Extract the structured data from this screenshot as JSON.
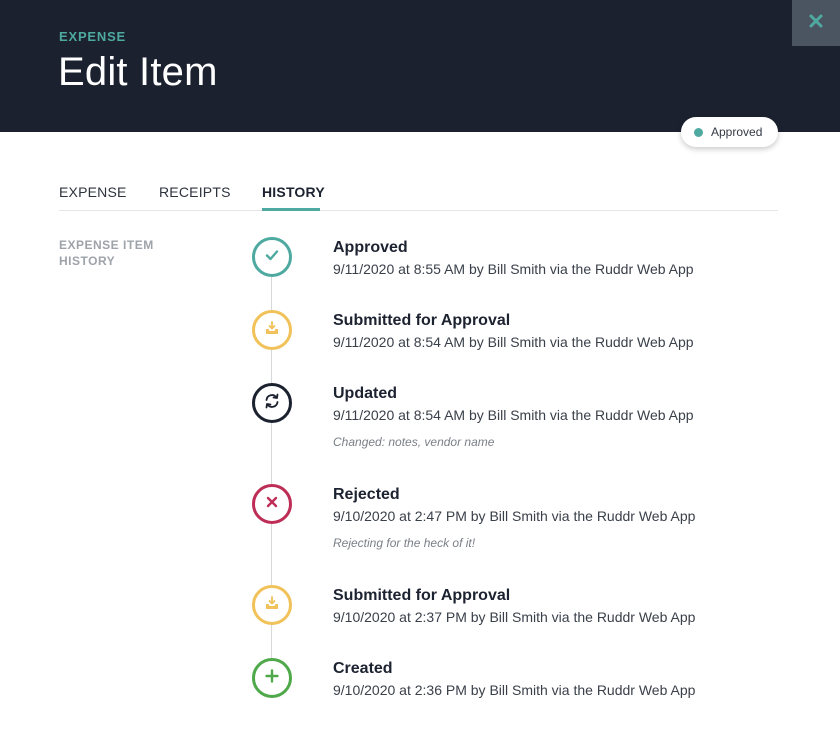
{
  "header": {
    "kicker": "EXPENSE",
    "title": "Edit Item",
    "close_icon": "close-icon"
  },
  "status": {
    "label": "Approved",
    "color": "#4eaaa0"
  },
  "tabs": [
    {
      "label": "EXPENSE",
      "active": false
    },
    {
      "label": "RECEIPTS",
      "active": false
    },
    {
      "label": "HISTORY",
      "active": true
    }
  ],
  "section": {
    "label": "EXPENSE ITEM HISTORY"
  },
  "history": [
    {
      "type": "approved",
      "icon": "check-icon",
      "title": "Approved",
      "meta": "9/11/2020 at 8:55 AM by Bill Smith via the Ruddr Web App",
      "note": ""
    },
    {
      "type": "submitted",
      "icon": "inbox-download-icon",
      "title": "Submitted for Approval",
      "meta": "9/11/2020 at 8:54 AM by Bill Smith via the Ruddr Web App",
      "note": ""
    },
    {
      "type": "updated",
      "icon": "sync-icon",
      "title": "Updated",
      "meta": "9/11/2020 at 8:54 AM by Bill Smith via the Ruddr Web App",
      "note": "Changed: notes, vendor name"
    },
    {
      "type": "rejected",
      "icon": "x-icon",
      "title": "Rejected",
      "meta": "9/10/2020 at 2:47 PM by Bill Smith via the Ruddr Web App",
      "note": "Rejecting for the heck of it!"
    },
    {
      "type": "submitted",
      "icon": "inbox-download-icon",
      "title": "Submitted for Approval",
      "meta": "9/10/2020 at 2:37 PM by Bill Smith via the Ruddr Web App",
      "note": ""
    },
    {
      "type": "created",
      "icon": "plus-icon",
      "title": "Created",
      "meta": "9/10/2020 at 2:36 PM by Bill Smith via the Ruddr Web App",
      "note": ""
    }
  ],
  "colors": {
    "header_bg": "#1b212e",
    "accent": "#4eaaa0",
    "submitted": "#f1c15a",
    "rejected": "#be2d56",
    "created": "#4fa94a"
  }
}
